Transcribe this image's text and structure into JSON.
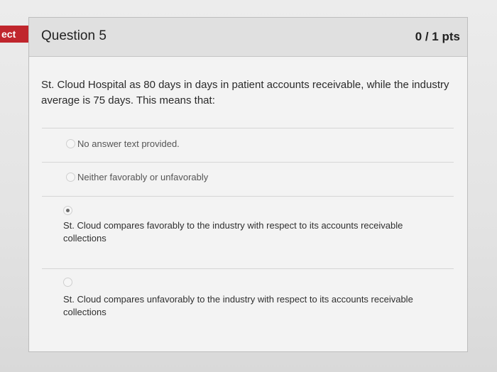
{
  "status_tag": "ect",
  "question": {
    "title": "Question 5",
    "points": "0 / 1 pts",
    "text": "St. Cloud Hospital as 80 days in days in patient accounts receivable, while the industry average is 75 days.  This means that:"
  },
  "answers": [
    {
      "text": "No answer text provided.",
      "selected": false
    },
    {
      "text": "Neither favorably or unfavorably",
      "selected": false
    },
    {
      "text": "St. Cloud compares favorably to the industry with respect to its accounts receivable collections",
      "selected": true
    },
    {
      "text": "St. Cloud compares unfavorably to the industry with respect to its accounts receivable collections",
      "selected": false
    }
  ]
}
